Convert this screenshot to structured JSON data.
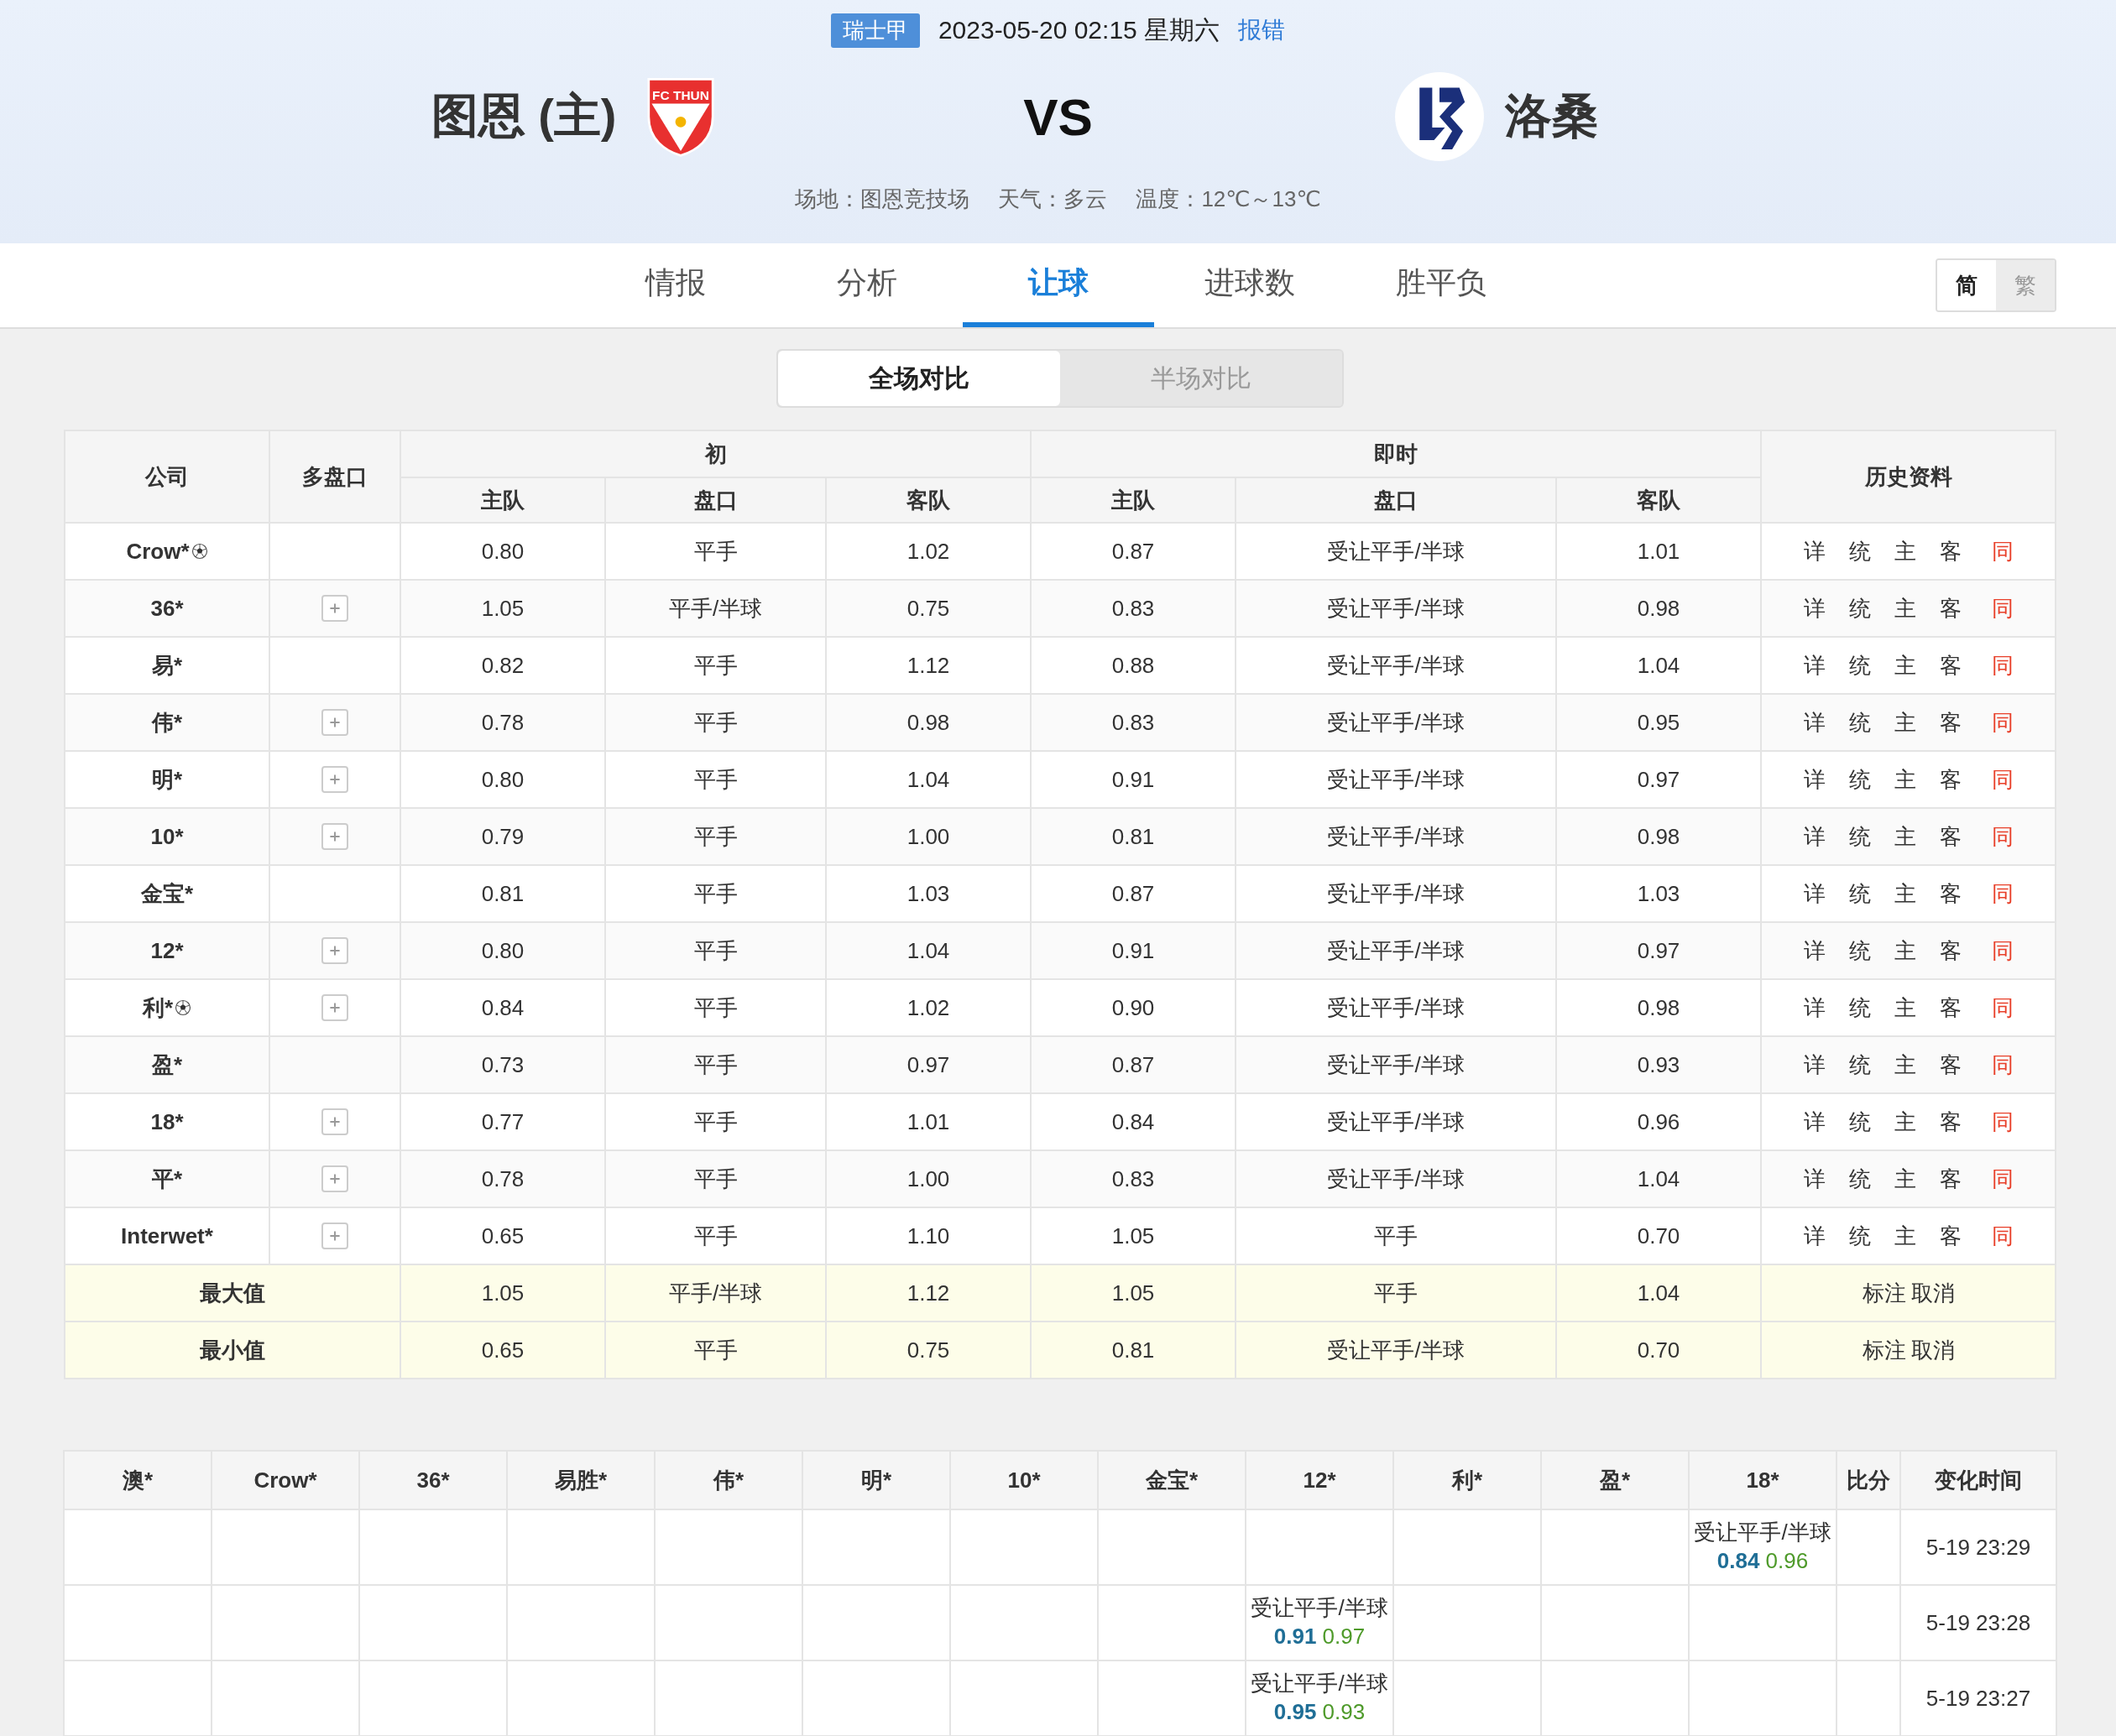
{
  "match": {
    "league": "瑞士甲",
    "datetime": "2023-05-20 02:15 星期六",
    "report_link": "报错",
    "home_team": "图恩 (主)",
    "home_logo_text": "FC THUN",
    "versus": "VS",
    "away_team": "洛桑",
    "info": [
      "场地：图恩竞技场",
      "天气：多云",
      "温度：12℃～13℃"
    ]
  },
  "tabs": [
    {
      "label": "情报",
      "selected": false
    },
    {
      "label": "分析",
      "selected": false
    },
    {
      "label": "让球",
      "selected": true
    },
    {
      "label": "进球数",
      "selected": false
    },
    {
      "label": "胜平负",
      "selected": false
    }
  ],
  "language_toggle": [
    {
      "label": "简",
      "selected": true
    },
    {
      "label": "繁",
      "selected": false
    }
  ],
  "compare_toggle": [
    {
      "label": "全场对比",
      "selected": true
    },
    {
      "label": "半场对比",
      "selected": false
    }
  ],
  "odds_table": {
    "headers": {
      "company": "公司",
      "multi": "多盘口",
      "initial": "初",
      "live": "即时",
      "history": "历史资料",
      "sub": [
        "主队",
        "盘口",
        "客队",
        "主队",
        "盘口",
        "客队"
      ]
    },
    "rows": [
      {
        "company": "Crow*",
        "ball": true,
        "multi": false,
        "values": [
          "0.80",
          "平手",
          "1.02",
          "0.87",
          "受让平手/半球",
          "1.01"
        ],
        "links": [
          "详",
          "统",
          "主",
          "客",
          "同"
        ]
      },
      {
        "company": "36*",
        "ball": false,
        "multi": true,
        "values": [
          "1.05",
          "平手/半球",
          "0.75",
          "0.83",
          "受让平手/半球",
          "0.98"
        ],
        "links": [
          "详",
          "统",
          "主",
          "客",
          "同"
        ]
      },
      {
        "company": "易*",
        "ball": false,
        "multi": false,
        "values": [
          "0.82",
          "平手",
          "1.12",
          "0.88",
          "受让平手/半球",
          "1.04"
        ],
        "links": [
          "详",
          "统",
          "主",
          "客",
          "同"
        ]
      },
      {
        "company": "伟*",
        "ball": false,
        "multi": true,
        "values": [
          "0.78",
          "平手",
          "0.98",
          "0.83",
          "受让平手/半球",
          "0.95"
        ],
        "links": [
          "详",
          "统",
          "主",
          "客",
          "同"
        ]
      },
      {
        "company": "明*",
        "ball": false,
        "multi": true,
        "values": [
          "0.80",
          "平手",
          "1.04",
          "0.91",
          "受让平手/半球",
          "0.97"
        ],
        "links": [
          "详",
          "统",
          "主",
          "客",
          "同"
        ]
      },
      {
        "company": "10*",
        "ball": false,
        "multi": true,
        "values": [
          "0.79",
          "平手",
          "1.00",
          "0.81",
          "受让平手/半球",
          "0.98"
        ],
        "links": [
          "详",
          "统",
          "主",
          "客",
          "同"
        ]
      },
      {
        "company": "金宝*",
        "ball": false,
        "multi": false,
        "values": [
          "0.81",
          "平手",
          "1.03",
          "0.87",
          "受让平手/半球",
          "1.03"
        ],
        "links": [
          "详",
          "统",
          "主",
          "客",
          "同"
        ]
      },
      {
        "company": "12*",
        "ball": false,
        "multi": true,
        "values": [
          "0.80",
          "平手",
          "1.04",
          "0.91",
          "受让平手/半球",
          "0.97"
        ],
        "links": [
          "详",
          "统",
          "主",
          "客",
          "同"
        ]
      },
      {
        "company": "利*",
        "ball": true,
        "multi": true,
        "values": [
          "0.84",
          "平手",
          "1.02",
          "0.90",
          "受让平手/半球",
          "0.98"
        ],
        "links": [
          "详",
          "统",
          "主",
          "客",
          "同"
        ]
      },
      {
        "company": "盈*",
        "ball": false,
        "multi": false,
        "values": [
          "0.73",
          "平手",
          "0.97",
          "0.87",
          "受让平手/半球",
          "0.93"
        ],
        "links": [
          "详",
          "统",
          "主",
          "客",
          "同"
        ]
      },
      {
        "company": "18*",
        "ball": false,
        "multi": true,
        "values": [
          "0.77",
          "平手",
          "1.01",
          "0.84",
          "受让平手/半球",
          "0.96"
        ],
        "links": [
          "详",
          "统",
          "主",
          "客",
          "同"
        ]
      },
      {
        "company": "平*",
        "ball": false,
        "multi": true,
        "values": [
          "0.78",
          "平手",
          "1.00",
          "0.83",
          "受让平手/半球",
          "1.04"
        ],
        "links": [
          "详",
          "统",
          "主",
          "客",
          "同"
        ]
      },
      {
        "company": "Interwet*",
        "ball": false,
        "multi": true,
        "values": [
          "0.65",
          "平手",
          "1.10",
          "1.05",
          "平手",
          "0.70"
        ],
        "links": [
          "详",
          "统",
          "主",
          "客",
          "同"
        ]
      }
    ],
    "summary": [
      {
        "label": "最大值",
        "values": [
          "1.05",
          "平手/半球",
          "1.12",
          "1.05",
          "平手",
          "1.04"
        ],
        "actions": [
          "标注",
          "取消"
        ]
      },
      {
        "label": "最小值",
        "values": [
          "0.65",
          "平手",
          "0.75",
          "0.81",
          "受让平手/半球",
          "0.70"
        ],
        "actions": [
          "标注",
          "取消"
        ]
      }
    ]
  },
  "change_table": {
    "columns": [
      "澳*",
      "Crow*",
      "36*",
      "易胜*",
      "伟*",
      "明*",
      "10*",
      "金宝*",
      "12*",
      "利*",
      "盈*",
      "18*",
      "比分",
      "变化时间"
    ],
    "rows": [
      {
        "cells": [
          null,
          null,
          null,
          null,
          null,
          null,
          null,
          null,
          null,
          null,
          null,
          {
            "line": "受让平手/半球",
            "home": "0.84",
            "away": "0.96"
          }
        ],
        "time": "5-19 23:29"
      },
      {
        "cells": [
          null,
          null,
          null,
          null,
          null,
          null,
          null,
          null,
          {
            "line": "受让平手/半球",
            "home": "0.91",
            "away": "0.97"
          },
          null,
          null,
          null
        ],
        "time": "5-19 23:28"
      },
      {
        "cells": [
          null,
          null,
          null,
          null,
          null,
          null,
          null,
          null,
          {
            "line": "受让平手/半球",
            "home": "0.95",
            "away": "0.93"
          },
          null,
          null,
          null
        ],
        "time": "5-19 23:27"
      }
    ]
  }
}
